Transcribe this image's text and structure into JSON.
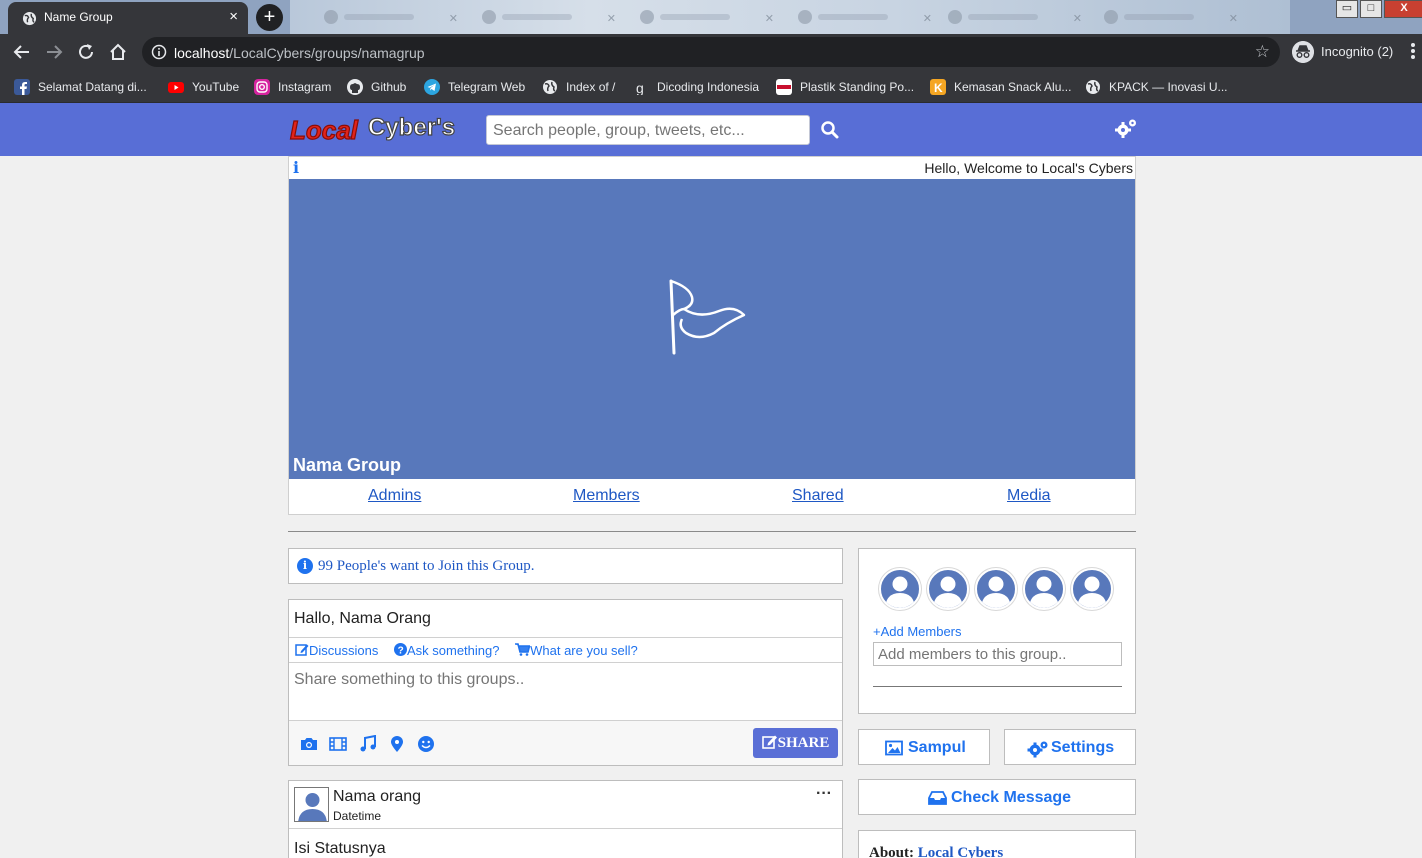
{
  "browser": {
    "tab_title": "Name Group",
    "tab_close": "×",
    "new_tab": "+",
    "url_host": "localhost",
    "url_path": "/LocalCybers/groups/namagrup",
    "profile_label": "Incognito (2)",
    "window_controls": [
      "▭",
      "□",
      "X"
    ],
    "bookmarks": [
      {
        "label": "Selamat Datang di...",
        "icon": "facebook-icon",
        "color": "#3b5998"
      },
      {
        "label": "YouTube",
        "icon": "youtube-icon",
        "color": "#ff0000"
      },
      {
        "label": "Instagram",
        "icon": "instagram-icon",
        "color": "#d6249f"
      },
      {
        "label": "Github",
        "icon": "github-icon",
        "color": "#e8eaed"
      },
      {
        "label": "Telegram Web",
        "icon": "telegram-icon",
        "color": "#2ca5e0"
      },
      {
        "label": "Index of /",
        "icon": "globe-icon",
        "color": "#e8eaed"
      },
      {
        "label": "Dicoding Indonesia",
        "icon": "dicoding-icon",
        "color": "#35363a"
      },
      {
        "label": "Plastik Standing Po...",
        "icon": "plastik-icon",
        "color": "#ffffff"
      },
      {
        "label": "Kemasan Snack Alu...",
        "icon": "kemasan-icon",
        "color": "#f5a623"
      },
      {
        "label": "KPACK — Inovasi U...",
        "icon": "globe-icon",
        "color": "#e8eaed"
      }
    ]
  },
  "site": {
    "logo_text": "Local Cyber's",
    "search_placeholder": "Search people, group, tweets, etc...",
    "welcome": "Hello, Welcome to Local's Cybers",
    "info_symbol": "i"
  },
  "group": {
    "name": "Nama Group",
    "tabs": [
      "Admins",
      "Members",
      "Shared",
      "Media"
    ]
  },
  "join_notice": "99 People's want to Join this Group.",
  "composer": {
    "greeting": "Hallo, Nama Orang",
    "post_types": [
      "Discussions",
      "Ask something?",
      "What are you sell?"
    ],
    "placeholder": "Share something to this groups..",
    "share_label": "SHARE"
  },
  "post": {
    "author": "Nama orang",
    "datetime": "Datetime",
    "more": "···",
    "body": "Isi Statusnya"
  },
  "sidebar": {
    "add_members_label": "+Add Members",
    "add_members_placeholder": "Add members to this group..",
    "sampul_label": "Sampul",
    "settings_label": "Settings",
    "check_message_label": "Check Message",
    "about_label": "About:",
    "about_value": "Local Cybers"
  },
  "colors": {
    "navbar": "#586ed6",
    "cover": "#5878bb",
    "link": "#1f72ee",
    "share_button": "#5a6fd6"
  }
}
